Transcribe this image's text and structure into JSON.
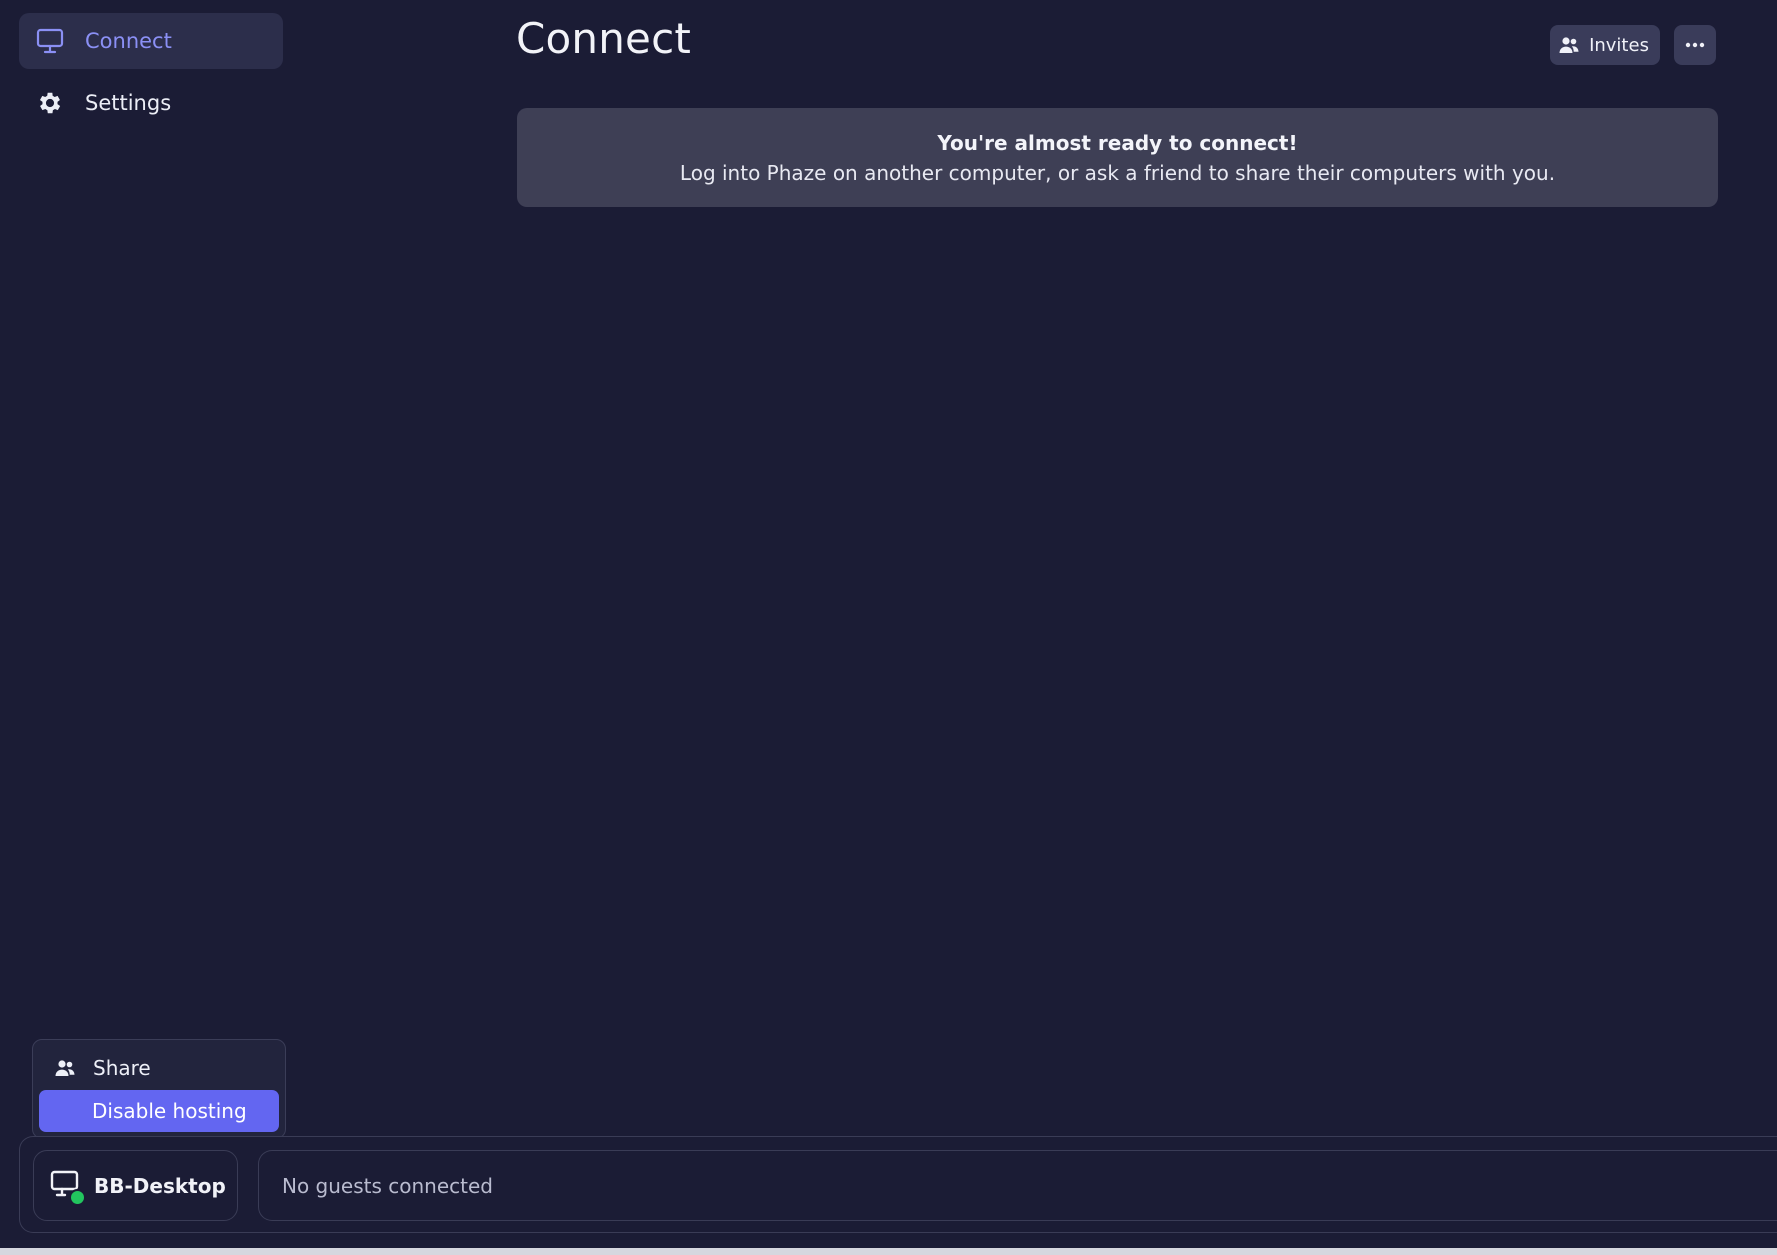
{
  "sidebar": {
    "items": [
      {
        "label": "Connect",
        "icon": "monitor-icon",
        "active": true
      },
      {
        "label": "Settings",
        "icon": "gear-icon",
        "active": false
      }
    ]
  },
  "header": {
    "title": "Connect",
    "invites_label": "Invites",
    "more_icon": "ellipsis-icon"
  },
  "banner": {
    "title": "You're almost ready to connect!",
    "body": "Log into Phaze on another computer, or ask a friend to share their computers with you."
  },
  "popover": {
    "share_label": "Share",
    "disable_label": "Disable hosting"
  },
  "bottom_bar": {
    "device_name": "BB-Desktop",
    "device_status": "online",
    "guests_text": "No guests connected"
  },
  "colors": {
    "background": "#1b1c35",
    "accent": "#6366f1",
    "active_text": "#8b90f5",
    "status_online": "#22c55e"
  }
}
